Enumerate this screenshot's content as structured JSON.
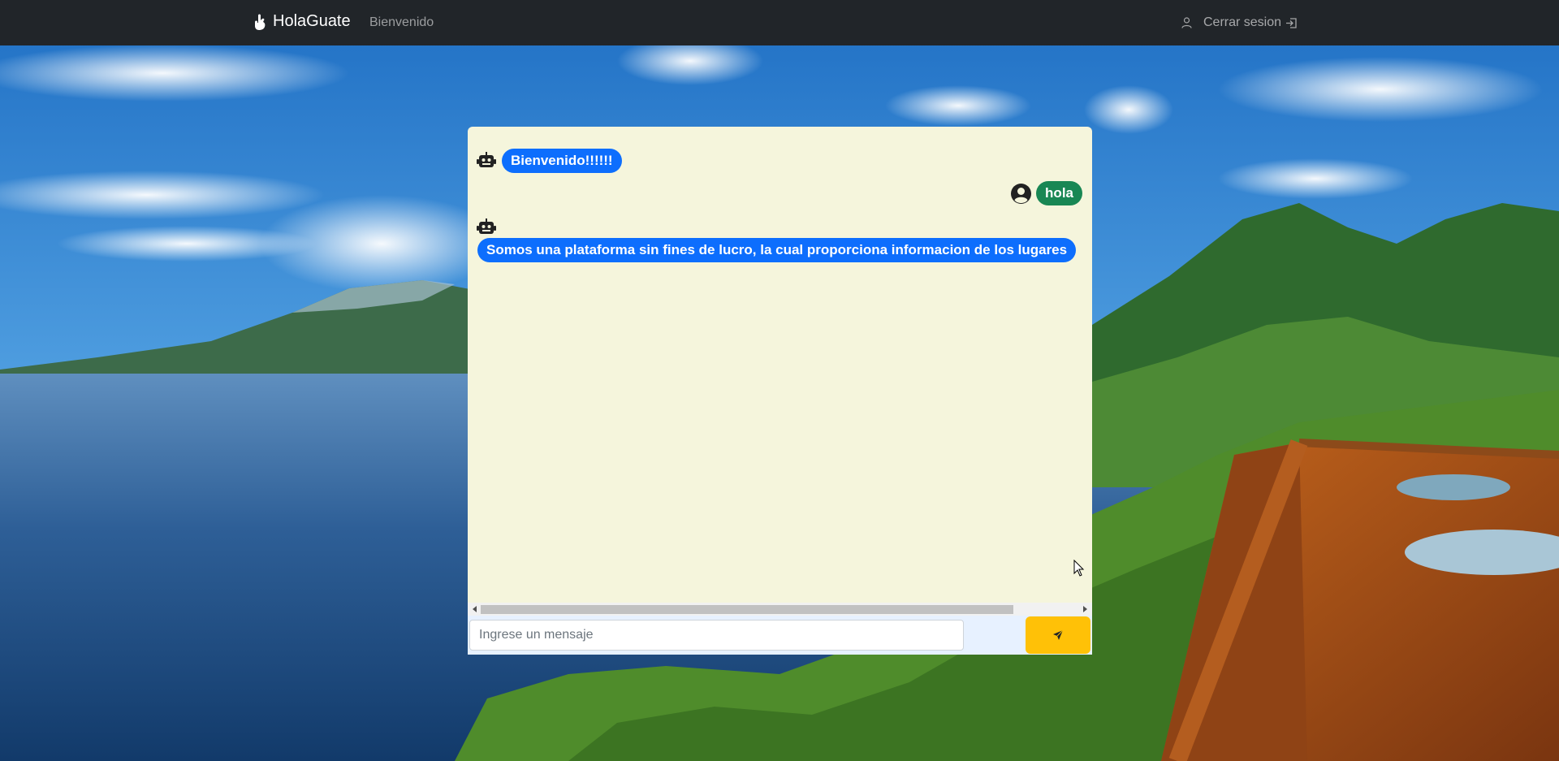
{
  "navbar": {
    "brand": "HolaGuate",
    "brand_icon": "hand-icon",
    "link_welcome": "Bienvenido",
    "logout_label": "Cerrar sesion",
    "logout_icons": [
      "user-icon",
      "exit-icon"
    ]
  },
  "chat": {
    "messages": [
      {
        "sender": "bot",
        "icon": "robot-icon",
        "text": "Bienvenido!!!!!!"
      },
      {
        "sender": "user",
        "icon": "user-circle-icon",
        "text": "hola"
      },
      {
        "sender": "bot",
        "icon": "robot-icon",
        "text": "Somos una plataforma sin fines de lucro, la cual proporciona informacion de los lugares"
      }
    ],
    "input_placeholder": "Ingrese un mensaje",
    "send_icon": "paper-plane-icon"
  },
  "colors": {
    "navbar": "#212529",
    "chat_bg": "#f5f5dc",
    "bot_bubble": "#0d6efd",
    "user_bubble": "#198754",
    "send_button": "#ffc107"
  }
}
